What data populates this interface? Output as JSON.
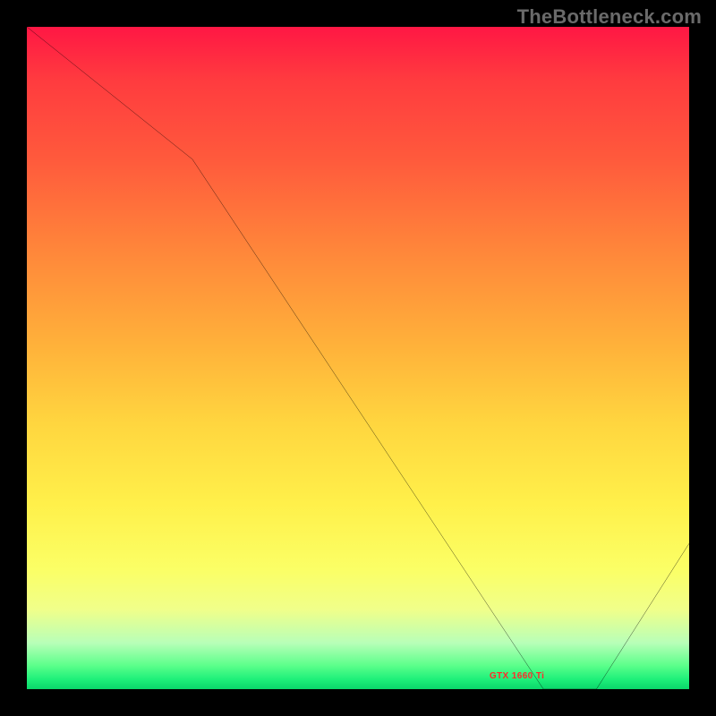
{
  "watermark": "TheBottleneck.com",
  "label_text": "GTX 1660 Ti",
  "chart_data": {
    "type": "line",
    "title": "",
    "xlabel": "",
    "ylabel": "",
    "xlim": [
      0,
      100
    ],
    "ylim": [
      0,
      100
    ],
    "series": [
      {
        "name": "bottleneck-curve",
        "x": [
          0,
          25,
          78,
          86,
          100
        ],
        "y": [
          100,
          80,
          0,
          0,
          22
        ]
      }
    ],
    "annotations": [
      {
        "text": "GTX 1660 Ti",
        "x": 82,
        "y": 0
      }
    ]
  }
}
